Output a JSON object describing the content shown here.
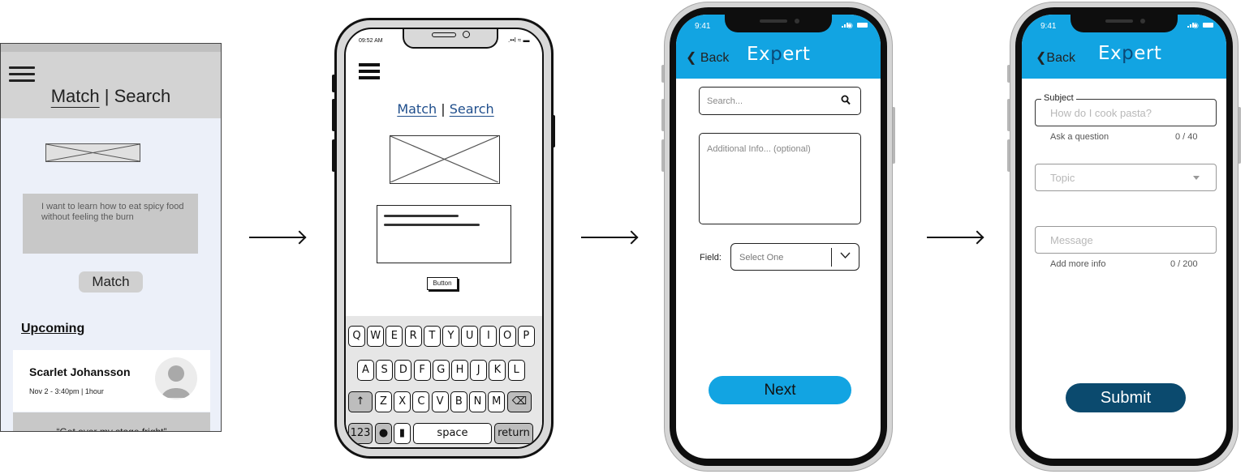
{
  "screen1": {
    "title_match": "Match",
    "title_sep": " | ",
    "title_search": "Search",
    "query_text": "I want to learn how to eat spicy food without feeling the burn",
    "match_button": "Match",
    "upcoming_heading": "Upcoming",
    "card": {
      "name": "Scarlet Johansson",
      "details": "Nov 2 - 3:40pm  |  1hour"
    },
    "next_card_text": "“Get over my stage fright”"
  },
  "screen2": {
    "time": "09:52 AM",
    "status": ".••l ≈ ▬",
    "title_match": "Match",
    "title_search": "Search",
    "button_label": "Button",
    "keyboard": {
      "row1": [
        "Q",
        "W",
        "E",
        "R",
        "T",
        "Y",
        "U",
        "I",
        "O",
        "P"
      ],
      "row2": [
        "A",
        "S",
        "D",
        "F",
        "G",
        "H",
        "J",
        "K",
        "L"
      ],
      "row3": [
        "Z",
        "X",
        "C",
        "V",
        "B",
        "N",
        "M"
      ],
      "shift": "↑",
      "delete": "⌫",
      "numbers": "123",
      "globe": "●",
      "mic": "▮",
      "space": "space",
      "return": "return"
    }
  },
  "screen3": {
    "time": "9:41",
    "back_label": "Back",
    "title_a": "Ex",
    "title_b": "p",
    "title_c": "ert",
    "search_placeholder": "Search...",
    "info_placeholder": "Additional Info... (optional)",
    "field_label": "Field:",
    "select_value": "Select One",
    "next_button": "Next"
  },
  "screen4": {
    "time": "9:41",
    "back_label": "Back",
    "title_a": "Ex",
    "title_b": "p",
    "title_c": "ert",
    "subject_legend": "Subject",
    "subject_placeholder": "How do I cook pasta?",
    "subject_help": "Ask a question",
    "subject_count": "0 / 40",
    "topic_placeholder": "Topic",
    "message_placeholder": "Message",
    "message_help": "Add more info",
    "message_count": "0 / 200",
    "submit_button": "Submit"
  },
  "colors": {
    "accent": "#12a4e2",
    "dark_accent": "#0b4a6e",
    "link_blue": "#1f4e8c"
  }
}
